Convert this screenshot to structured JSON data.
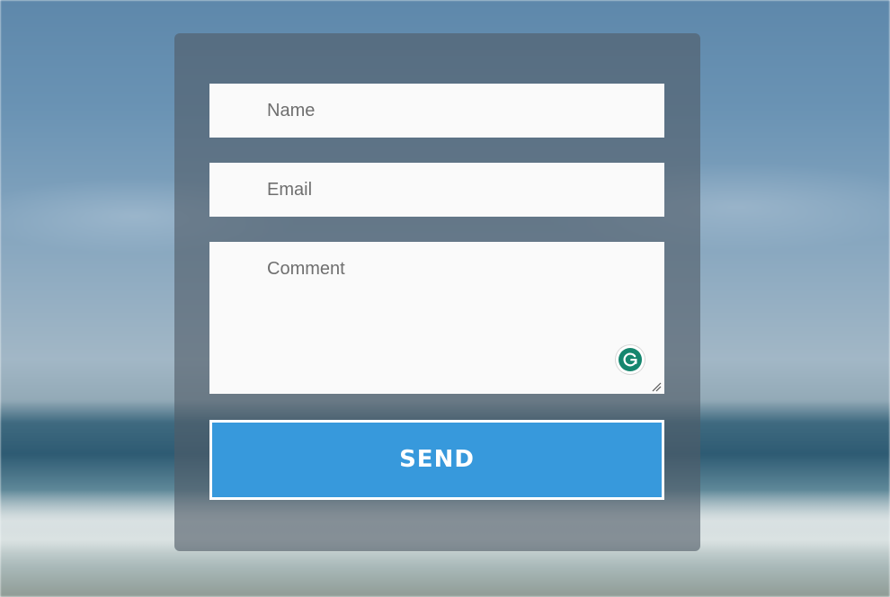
{
  "form": {
    "name_placeholder": "Name",
    "email_placeholder": "Email",
    "comment_placeholder": "Comment",
    "send_label": "SEND"
  },
  "icons": {
    "grammarly": "grammarly-icon",
    "resize": "resize-handle-icon"
  },
  "colors": {
    "button": "#3799dc",
    "panel": "#505c68",
    "field": "#fafafa",
    "placeholder": "#6f6f6f",
    "grammarly": "#15866e"
  }
}
